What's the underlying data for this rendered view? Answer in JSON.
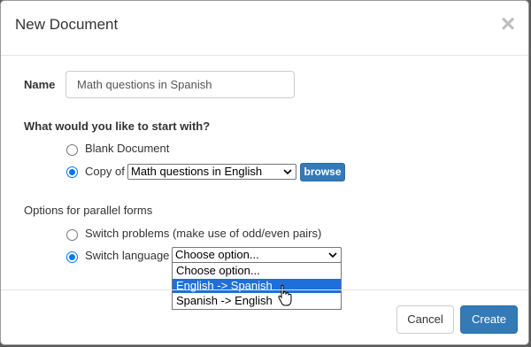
{
  "dialog": {
    "title": "New Document",
    "close_icon": "close-icon"
  },
  "name_field": {
    "label": "Name",
    "value": "Math questions in Spanish"
  },
  "start_section": {
    "heading": "What would you like to start with?",
    "options": [
      {
        "label": "Blank Document",
        "checked": false
      },
      {
        "label": "Copy of",
        "checked": true
      }
    ],
    "copy_select_value": "Math questions in English",
    "browse_label": "browse"
  },
  "parallel_section": {
    "heading": "Options for parallel forms",
    "options": [
      {
        "label": "Switch problems (make use of odd/even pairs)",
        "checked": false
      },
      {
        "label": "Switch language",
        "checked": true
      }
    ],
    "language_select_value": "Choose option...",
    "language_options": [
      "Choose option...",
      "English -> Spanish",
      "Spanish -> English"
    ],
    "highlighted_option": "English -> Spanish"
  },
  "footer": {
    "cancel_label": "Cancel",
    "create_label": "Create"
  },
  "colors": {
    "primary": "#337ab7",
    "highlight": "#1e6fd9",
    "radio_checked": "#0075ff"
  }
}
